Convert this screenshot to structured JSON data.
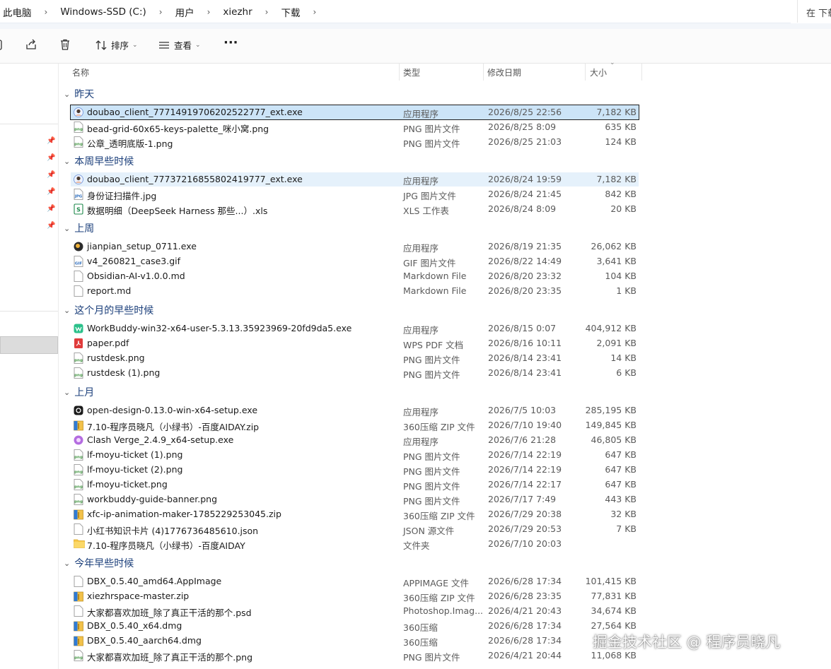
{
  "breadcrumb": [
    "此电脑",
    "Windows-SSD (C:)",
    "用户",
    "xiezhr",
    "下载"
  ],
  "search_placeholder": "在 下载",
  "toolbar": {
    "sort_label": "排序",
    "view_label": "查看",
    "more_label": "···"
  },
  "columns": {
    "name": "名称",
    "type": "类型",
    "modified": "修改日期",
    "size": "大小"
  },
  "groups": [
    {
      "label": "昨天",
      "rows": [
        {
          "name": "doubao_client_77714919706202522777_ext.exe",
          "type": "应用程序",
          "date": "2026/8/25 22:56",
          "size": "7,182 KB",
          "icon": "doubao-app-icon",
          "state": "selected"
        },
        {
          "name": "bead-grid-60x65-keys-palette_咪小窝.png",
          "type": "PNG 图片文件",
          "date": "2026/8/25 8:09",
          "size": "635 KB",
          "icon": "png-file-icon"
        },
        {
          "name": "公章_透明底版-1.png",
          "type": "PNG 图片文件",
          "date": "2026/8/25 21:03",
          "size": "124 KB",
          "icon": "png-file-icon"
        }
      ]
    },
    {
      "label": "本周早些时候",
      "rows": [
        {
          "name": "doubao_client_77737216855802419777_ext.exe",
          "type": "应用程序",
          "date": "2026/8/24 19:59",
          "size": "7,182 KB",
          "icon": "doubao-app-icon",
          "state": "hover"
        },
        {
          "name": "身份证扫描件.jpg",
          "type": "JPG 图片文件",
          "date": "2026/8/24 21:45",
          "size": "842 KB",
          "icon": "jpg-file-icon"
        },
        {
          "name": "数据明细（DeepSeek Harness  那些...）.xls",
          "type": "XLS 工作表",
          "date": "2026/8/24 8:09",
          "size": "20 KB",
          "icon": "xls-file-icon"
        }
      ]
    },
    {
      "label": "上周",
      "rows": [
        {
          "name": "jianpian_setup_0711.exe",
          "type": "应用程序",
          "date": "2026/8/19 21:35",
          "size": "26,062 KB",
          "icon": "jianpian-app-icon"
        },
        {
          "name": "v4_260821_case3.gif",
          "type": "GIF 图片文件",
          "date": "2026/8/22 14:49",
          "size": "3,641 KB",
          "icon": "gif-file-icon"
        },
        {
          "name": "Obsidian-AI-v1.0.0.md",
          "type": "Markdown File",
          "date": "2026/8/20 23:32",
          "size": "104 KB",
          "icon": "md-file-icon"
        },
        {
          "name": "report.md",
          "type": "Markdown File",
          "date": "2026/8/20 23:35",
          "size": "1 KB",
          "icon": "md-file-icon"
        }
      ]
    },
    {
      "label": "这个月的早些时候",
      "rows": [
        {
          "name": "WorkBuddy-win32-x64-user-5.3.13.35923969-20fd9da5.exe",
          "type": "应用程序",
          "date": "2026/8/15 0:07",
          "size": "404,912 KB",
          "icon": "workbuddy-app-icon"
        },
        {
          "name": "paper.pdf",
          "type": "WPS PDF 文档",
          "date": "2026/8/16 10:11",
          "size": "2,091 KB",
          "icon": "pdf-file-icon"
        },
        {
          "name": "rustdesk.png",
          "type": "PNG 图片文件",
          "date": "2026/8/14 23:41",
          "size": "14 KB",
          "icon": "png-file-icon"
        },
        {
          "name": "rustdesk (1).png",
          "type": "PNG 图片文件",
          "date": "2026/8/14 23:41",
          "size": "6 KB",
          "icon": "png-file-icon"
        }
      ]
    },
    {
      "label": "上月",
      "rows": [
        {
          "name": "open-design-0.13.0-win-x64-setup.exe",
          "type": "应用程序",
          "date": "2026/7/5 10:03",
          "size": "285,195 KB",
          "icon": "open-design-app-icon"
        },
        {
          "name": "7.10-程序员晓凡（小绿书）-百度AIDAY.zip",
          "type": "360压缩 ZIP 文件",
          "date": "2026/7/10 19:40",
          "size": "149,845 KB",
          "icon": "zip-file-icon"
        },
        {
          "name": "Clash Verge_2.4.9_x64-setup.exe",
          "type": "应用程序",
          "date": "2026/7/6 21:28",
          "size": "46,805 KB",
          "icon": "clash-app-icon"
        },
        {
          "name": "lf-moyu-ticket (1).png",
          "type": "PNG 图片文件",
          "date": "2026/7/14 22:19",
          "size": "647 KB",
          "icon": "png-file-icon"
        },
        {
          "name": "lf-moyu-ticket (2).png",
          "type": "PNG 图片文件",
          "date": "2026/7/14 22:19",
          "size": "647 KB",
          "icon": "png-file-icon"
        },
        {
          "name": "lf-moyu-ticket.png",
          "type": "PNG 图片文件",
          "date": "2026/7/14 22:17",
          "size": "647 KB",
          "icon": "png-file-icon"
        },
        {
          "name": "workbuddy-guide-banner.png",
          "type": "PNG 图片文件",
          "date": "2026/7/17 7:49",
          "size": "443 KB",
          "icon": "png-file-icon"
        },
        {
          "name": "xfc-ip-animation-maker-1785229253045.zip",
          "type": "360压缩 ZIP 文件",
          "date": "2026/7/29 20:38",
          "size": "32 KB",
          "icon": "zip-file-icon"
        },
        {
          "name": "小红书知识卡片 (4)1776736485610.json",
          "type": "JSON 源文件",
          "date": "2026/7/29 20:53",
          "size": "7 KB",
          "icon": "json-file-icon"
        },
        {
          "name": "7.10-程序员晓凡（小绿书）-百度AIDAY",
          "type": "文件夹",
          "date": "2026/7/10 20:03",
          "size": "",
          "icon": "folder-icon"
        }
      ]
    },
    {
      "label": "今年早些时候",
      "rows": [
        {
          "name": "DBX_0.5.40_amd64.AppImage",
          "type": "APPIMAGE 文件",
          "date": "2026/6/28 17:34",
          "size": "101,415 KB",
          "icon": "blank-file-icon"
        },
        {
          "name": "xiezhrspace-master.zip",
          "type": "360压缩 ZIP 文件",
          "date": "2026/6/28 23:35",
          "size": "77,831 KB",
          "icon": "zip-file-icon"
        },
        {
          "name": "大家都喜欢加班_除了真正干活的那个.psd",
          "type": "Photoshop.Imag...",
          "date": "2026/4/21 20:43",
          "size": "34,674 KB",
          "icon": "blank-file-icon"
        },
        {
          "name": "DBX_0.5.40_x64.dmg",
          "type": "360压缩",
          "date": "2026/6/28 17:34",
          "size": "27,564 KB",
          "icon": "zip-file-icon"
        },
        {
          "name": "DBX_0.5.40_aarch64.dmg",
          "type": "360压缩",
          "date": "2026/6/28 17:34",
          "size": "",
          "icon": "zip-file-icon"
        },
        {
          "name": "大家都喜欢加班_除了真正干活的那个.png",
          "type": "PNG 图片文件",
          "date": "2026/4/21 20:44",
          "size": "11,068 KB",
          "icon": "png-file-icon"
        }
      ]
    }
  ],
  "watermark": "掘金技术社区 @ 程序员晓凡"
}
